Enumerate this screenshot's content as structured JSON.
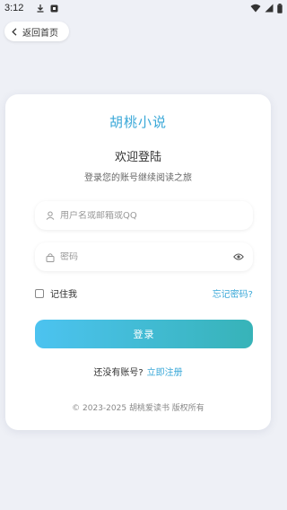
{
  "status_bar": {
    "time": "3:12"
  },
  "nav": {
    "back_label": "返回首页"
  },
  "card": {
    "brand": "胡桃小说",
    "welcome": "欢迎登陆",
    "subtitle": "登录您的账号继续阅读之旅"
  },
  "form": {
    "username_placeholder": "用户名或邮箱或QQ",
    "username_value": "",
    "password_placeholder": "密码",
    "password_value": "",
    "remember_label": "记住我",
    "remember_checked": false,
    "forgot_label": "忘记密码?",
    "login_label": "登录"
  },
  "register": {
    "prompt": "还没有账号?",
    "link": "立即注册"
  },
  "footer": {
    "copyright": "© 2023-2025 胡桃爱读书 版权所有"
  },
  "colors": {
    "accent": "#3aa8d8",
    "button_gradient_start": "#4cc3f0",
    "button_gradient_end": "#37b3b8",
    "background": "#eef0f6"
  },
  "icons": [
    "download-icon",
    "app-notification-icon",
    "wifi-icon",
    "signal-icon",
    "battery-icon",
    "chevron-left-icon",
    "user-icon",
    "lock-icon",
    "eye-icon"
  ]
}
